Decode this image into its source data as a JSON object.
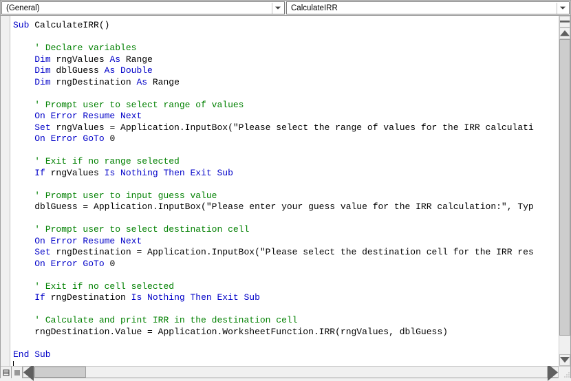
{
  "dropdowns": {
    "object": "(General)",
    "procedure": "CalculateIRR"
  },
  "code": {
    "lines": [
      [
        [
          "kw",
          "Sub"
        ],
        [
          "tx",
          " CalculateIRR()"
        ]
      ],
      [],
      [
        [
          "ind",
          1
        ],
        [
          "cm",
          "' Declare variables"
        ]
      ],
      [
        [
          "ind",
          1
        ],
        [
          "kw",
          "Dim"
        ],
        [
          "tx",
          " rngValues "
        ],
        [
          "kw",
          "As"
        ],
        [
          "tx",
          " Range"
        ]
      ],
      [
        [
          "ind",
          1
        ],
        [
          "kw",
          "Dim"
        ],
        [
          "tx",
          " dblGuess "
        ],
        [
          "kw",
          "As Double"
        ]
      ],
      [
        [
          "ind",
          1
        ],
        [
          "kw",
          "Dim"
        ],
        [
          "tx",
          " rngDestination "
        ],
        [
          "kw",
          "As"
        ],
        [
          "tx",
          " Range"
        ]
      ],
      [],
      [
        [
          "ind",
          1
        ],
        [
          "cm",
          "' Prompt user to select range of values"
        ]
      ],
      [
        [
          "ind",
          1
        ],
        [
          "kw",
          "On Error Resume Next"
        ]
      ],
      [
        [
          "ind",
          1
        ],
        [
          "kw",
          "Set"
        ],
        [
          "tx",
          " rngValues = Application.InputBox(\"Please select the range of values for the IRR calculati"
        ]
      ],
      [
        [
          "ind",
          1
        ],
        [
          "kw",
          "On Error GoTo"
        ],
        [
          "tx",
          " 0"
        ]
      ],
      [],
      [
        [
          "ind",
          1
        ],
        [
          "cm",
          "' Exit if no range selected"
        ]
      ],
      [
        [
          "ind",
          1
        ],
        [
          "kw",
          "If"
        ],
        [
          "tx",
          " rngValues "
        ],
        [
          "kw",
          "Is Nothing Then Exit Sub"
        ]
      ],
      [],
      [
        [
          "ind",
          1
        ],
        [
          "cm",
          "' Prompt user to input guess value"
        ]
      ],
      [
        [
          "ind",
          1
        ],
        [
          "tx",
          "dblGuess = Application.InputBox(\"Please enter your guess value for the IRR calculation:\", Typ"
        ]
      ],
      [],
      [
        [
          "ind",
          1
        ],
        [
          "cm",
          "' Prompt user to select destination cell"
        ]
      ],
      [
        [
          "ind",
          1
        ],
        [
          "kw",
          "On Error Resume Next"
        ]
      ],
      [
        [
          "ind",
          1
        ],
        [
          "kw",
          "Set"
        ],
        [
          "tx",
          " rngDestination = Application.InputBox(\"Please select the destination cell for the IRR res"
        ]
      ],
      [
        [
          "ind",
          1
        ],
        [
          "kw",
          "On Error GoTo"
        ],
        [
          "tx",
          " 0"
        ]
      ],
      [],
      [
        [
          "ind",
          1
        ],
        [
          "cm",
          "' Exit if no cell selected"
        ]
      ],
      [
        [
          "ind",
          1
        ],
        [
          "kw",
          "If"
        ],
        [
          "tx",
          " rngDestination "
        ],
        [
          "kw",
          "Is Nothing Then Exit Sub"
        ]
      ],
      [],
      [
        [
          "ind",
          1
        ],
        [
          "cm",
          "' Calculate and print IRR in the destination cell"
        ]
      ],
      [
        [
          "ind",
          1
        ],
        [
          "tx",
          "rngDestination.Value = Application.WorksheetFunction.IRR(rngValues, dblGuess)"
        ]
      ],
      [],
      [
        [
          "kw",
          "End Sub"
        ]
      ]
    ],
    "indent_unit": "    "
  }
}
